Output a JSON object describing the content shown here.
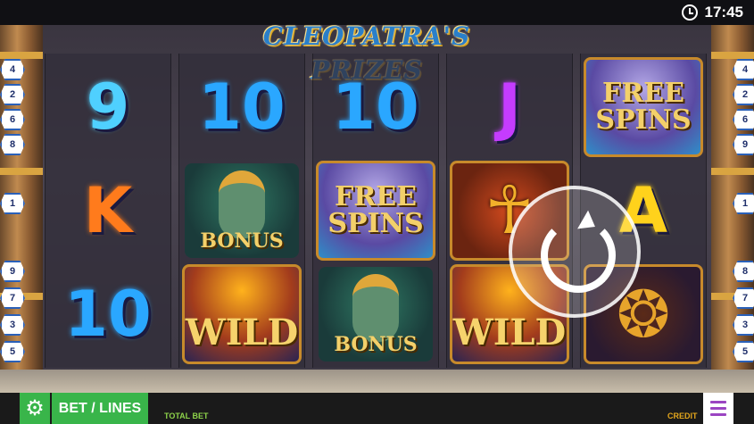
{
  "status_bar": {
    "time": "17:45",
    "clock_icon": "clock-icon"
  },
  "game": {
    "title": "CLEOPATRA'S PRIZES"
  },
  "reels": [
    [
      {
        "type": "letter",
        "text": "9",
        "color": "#4fd0ff"
      },
      {
        "type": "letter",
        "text": "K",
        "color": "#ff7b1c"
      },
      {
        "type": "letter",
        "text": "10",
        "color": "#2aa7ff"
      }
    ],
    [
      {
        "type": "letter",
        "text": "10",
        "color": "#2aa7ff"
      },
      {
        "type": "bonus",
        "text": "BONUS"
      },
      {
        "type": "wild",
        "text": "WILD"
      }
    ],
    [
      {
        "type": "letter",
        "text": "10",
        "color": "#2aa7ff"
      },
      {
        "type": "free_spins",
        "line1": "FREE",
        "line2": "SPINS"
      },
      {
        "type": "bonus",
        "text": "BONUS"
      }
    ],
    [
      {
        "type": "letter",
        "text": "J",
        "color": "#c53cff"
      },
      {
        "type": "ankh",
        "icon": "ankh-icon"
      },
      {
        "type": "wild",
        "text": "WILD"
      }
    ],
    [
      {
        "type": "free_spins",
        "line1": "FREE",
        "line2": "SPINS"
      },
      {
        "type": "letter",
        "text": "A",
        "color": "#ffd21c"
      },
      {
        "type": "scarab",
        "icon": "scarab-icon"
      }
    ]
  ],
  "paylines": {
    "left": [
      "4",
      "2",
      "6",
      "8",
      "1",
      "9",
      "7",
      "3",
      "5"
    ],
    "right": [
      "4",
      "2",
      "6",
      "9",
      "1",
      "8",
      "7",
      "3",
      "5"
    ]
  },
  "controls": {
    "spin_icon": "spin-icon",
    "settings_icon": "gear-icon",
    "bet_lines_label": "BET / LINES",
    "total_bet_label": "TOTAL BET",
    "credit_label": "CREDIT",
    "menu_icon": "menu-icon"
  },
  "colors": {
    "accent_green": "#39b54a",
    "credit_orange": "#e3a61c",
    "menu_purple": "#9b45c2"
  }
}
